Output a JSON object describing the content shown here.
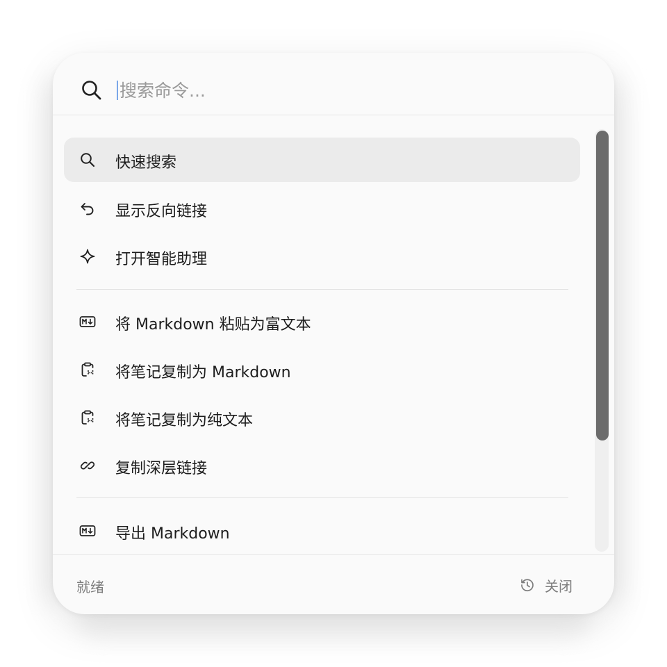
{
  "search": {
    "placeholder": "搜索命令...",
    "value": "",
    "icon": "search-icon"
  },
  "commands": [
    {
      "label": "快速搜索",
      "icon": "search-icon",
      "selected": true
    },
    {
      "label": "显示反向链接",
      "icon": "undo-arrow-icon",
      "selected": false
    },
    {
      "label": "打开智能助理",
      "icon": "sparkle-icon",
      "selected": false
    },
    {
      "label": "将 Markdown 粘贴为富文本",
      "icon": "markdown-icon",
      "selected": false
    },
    {
      "label": "将笔记复制为 Markdown",
      "icon": "clipboard-icon",
      "selected": false
    },
    {
      "label": "将笔记复制为纯文本",
      "icon": "clipboard-icon",
      "selected": false
    },
    {
      "label": "复制深层链接",
      "icon": "link-icon",
      "selected": false
    },
    {
      "label": "导出 Markdown",
      "icon": "markdown-icon",
      "selected": false
    }
  ],
  "footer": {
    "status": "就绪",
    "close_label": "关闭",
    "close_icon": "history-icon"
  },
  "colors": {
    "selected_bg": "#ebebeb",
    "scroll_thumb": "#6c6c6c",
    "caret": "#7aa7e8"
  }
}
